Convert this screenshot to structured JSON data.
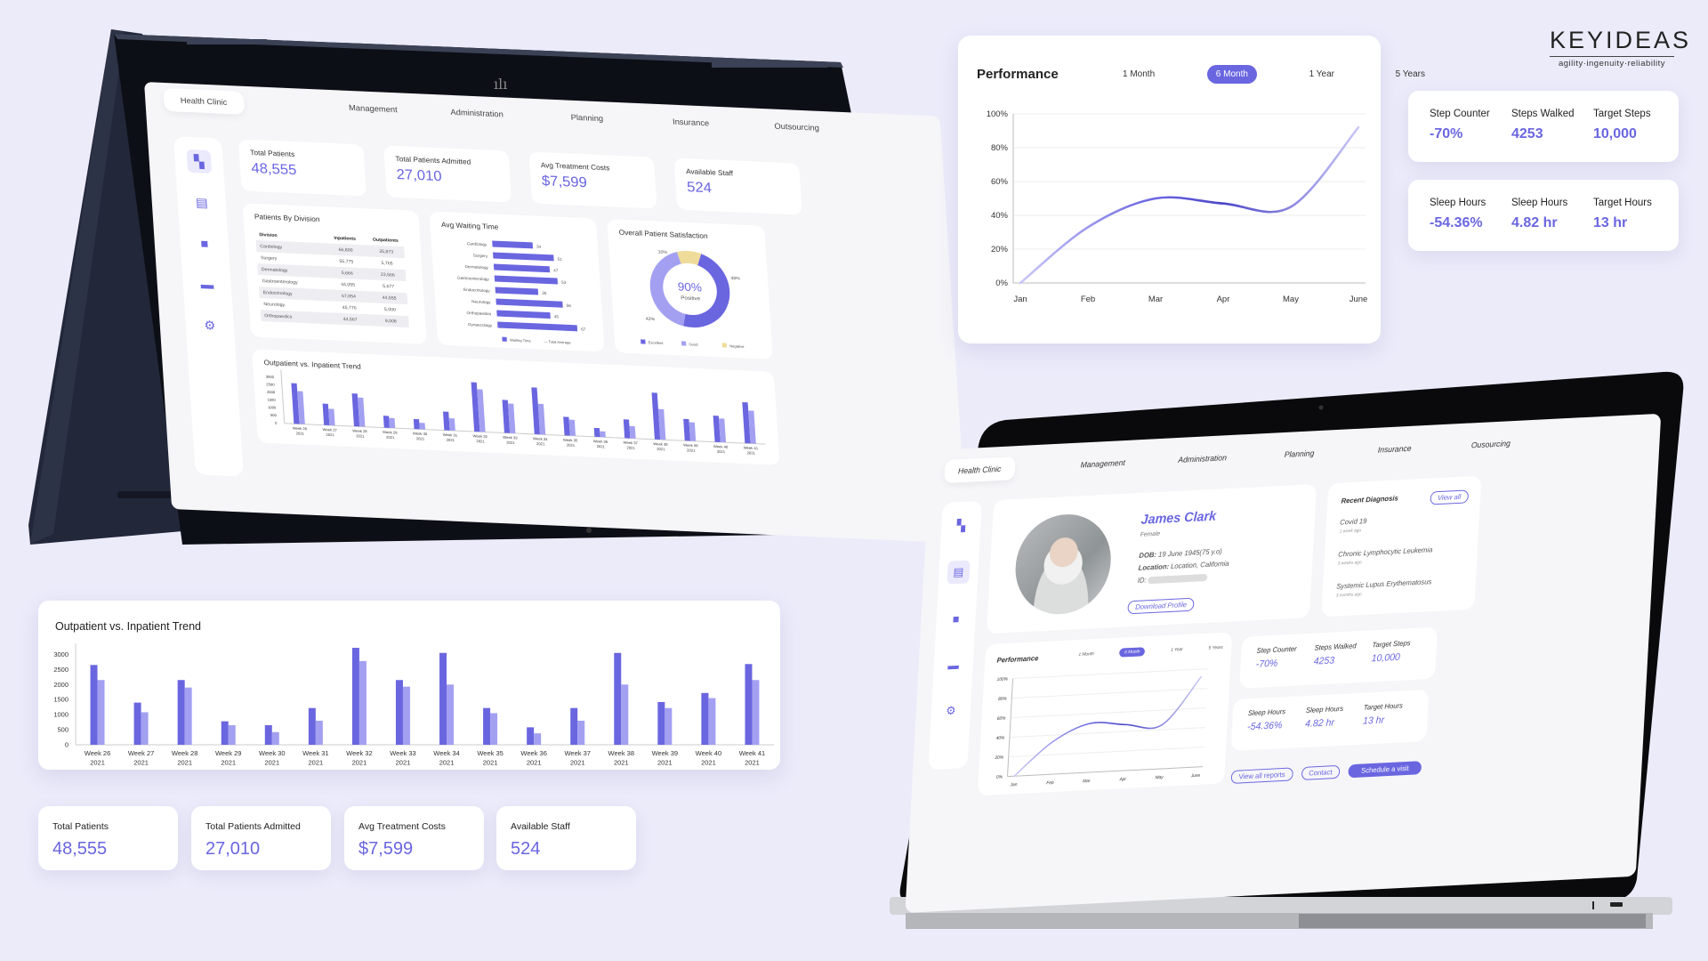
{
  "brand": {
    "logo_name": "KEYIDEAS",
    "logo_tagline": "agility·ingenuity·reliability"
  },
  "colors": {
    "accent": "#6a66e0",
    "accent_light": "#a3a0f2",
    "negative_yellow": "#f0dc9a",
    "background": "#ecebfa"
  },
  "nav": {
    "brand": "Health Clinic",
    "items": [
      "Management",
      "Administration",
      "Planning",
      "Insurance",
      "Outsourcing"
    ],
    "laptop_items": [
      "Management",
      "Administration",
      "Planning",
      "Insurance",
      "Ousourcing"
    ]
  },
  "sidebar_icons": [
    "dashboard-icon",
    "card-icon",
    "briefcase-icon",
    "folder-icon",
    "gear-icon"
  ],
  "kpis": [
    {
      "label": "Total Patients",
      "value": "48,555"
    },
    {
      "label": "Total Patients Admitted",
      "value": "27,010"
    },
    {
      "label": "Avg Treatment Costs",
      "value": "$7,599"
    },
    {
      "label": "Available Staff",
      "value": "524"
    }
  ],
  "performance": {
    "title": "Performance",
    "tabs": [
      "1 Month",
      "6 Month",
      "1 Year",
      "5 Years"
    ],
    "active_tab": "6 Month"
  },
  "steps": {
    "row1": [
      {
        "label": "Step Counter",
        "value": "-70%"
      },
      {
        "label": "Steps Walked",
        "value": "4253"
      },
      {
        "label": "Target Steps",
        "value": "10,000"
      }
    ],
    "row2": [
      {
        "label": "Sleep Hours",
        "value": "-54.36%"
      },
      {
        "label": "Sleep Hours",
        "value": "4.82 hr"
      },
      {
        "label": "Target Hours",
        "value": "13 hr"
      }
    ]
  },
  "patients_by_division": {
    "title": "Patients By Division",
    "columns": [
      "Division",
      "Inpatients",
      "Outpatients"
    ],
    "rows": [
      [
        "Cardiology",
        "66,800",
        "35,873"
      ],
      [
        "Surgery",
        "55,775",
        "5,765"
      ],
      [
        "Dermatology",
        "5,666",
        "23,566"
      ],
      [
        "Gastroenterology",
        "44,055",
        "5,677"
      ],
      [
        "Endocrinology",
        "67,854",
        "44,555"
      ],
      [
        "Neurology",
        "45,776",
        "5,000"
      ],
      [
        "Orthopaedics",
        "44,567",
        "9,008"
      ]
    ]
  },
  "patient_profile": {
    "name": "James Clark",
    "gender": "Female",
    "dob_label": "DOB:",
    "dob": "19 June 1945(75 y.o)",
    "location_label": "Location:",
    "location": "Location, California",
    "id_label": "ID:",
    "download_label": "Download Profile"
  },
  "recent_diagnosis": {
    "title": "Recent Diagnosis",
    "view_all": "View all",
    "items": [
      {
        "name": "Covid 19",
        "when": "1 week ago"
      },
      {
        "name": "Chronic Lymphocytic Leukemia",
        "when": "3 weeks ago"
      },
      {
        "name": "Systemic Lupus Erythematosus",
        "when": "3 months ago"
      }
    ]
  },
  "laptop_actions": {
    "view_reports": "View all reports",
    "contact": "Contact",
    "schedule": "Schedule a visit"
  },
  "chart_data": [
    {
      "id": "performance",
      "type": "line",
      "title": "Performance",
      "categories": [
        "Jan",
        "Feb",
        "Mar",
        "Apr",
        "May",
        "June"
      ],
      "x": [
        0,
        1,
        2,
        3,
        4,
        5
      ],
      "series": [
        {
          "name": "Performance",
          "values": [
            0,
            33,
            50,
            47,
            45,
            92
          ]
        }
      ],
      "yticks": [
        "0%",
        "20%",
        "40%",
        "60%",
        "80%",
        "100%"
      ],
      "ylim": [
        0,
        100
      ],
      "grid": true
    },
    {
      "id": "outpatient-inpatient-trend",
      "type": "bar",
      "title": "Outpatient vs. Inpatient Trend",
      "categories": [
        "Week 26",
        "Week 27",
        "Week 28",
        "Week 29",
        "Week 30",
        "Week 31",
        "Week 32",
        "Week 33",
        "Week 34",
        "Week 35",
        "Week 36",
        "Week 37",
        "Week 38",
        "Week 39",
        "Week 40",
        "Week 41"
      ],
      "category_sublabel": "2021",
      "series": [
        {
          "name": "Outpatient",
          "values": [
            2650,
            1400,
            2150,
            780,
            650,
            1220,
            3220,
            2150,
            3050,
            1220,
            580,
            1220,
            3050,
            1420,
            1720,
            2680
          ]
        },
        {
          "name": "Inpatient",
          "values": [
            2150,
            1080,
            1900,
            650,
            420,
            800,
            2780,
            1930,
            2000,
            1050,
            380,
            800,
            2000,
            1220,
            1550,
            2150
          ]
        }
      ],
      "yticks": [
        0,
        500,
        1000,
        1500,
        2000,
        2500,
        3000
      ],
      "ylim": [
        0,
        3250
      ],
      "grid": false
    },
    {
      "id": "avg-waiting-time",
      "type": "bar",
      "title": "Avg Waiting Time",
      "categories": [
        "Cardiology",
        "Surgery",
        "Dermatology",
        "Gastroenterology",
        "Endocrinology",
        "Neurology",
        "Orthopaedics",
        "Gynaecology"
      ],
      "series": [
        {
          "name": "Waiting Time",
          "values": [
            34,
            51,
            47,
            53,
            36,
            56,
            45,
            67
          ]
        }
      ],
      "legend": [
        "Waiting Time",
        "Total Average"
      ]
    },
    {
      "id": "overall-patient-satisfaction",
      "type": "pie",
      "title": "Overall Patient Satisfaction",
      "center_value": "90%",
      "center_label": "Positive",
      "slices": [
        {
          "label": "Excellent",
          "value": 48
        },
        {
          "label": "Good",
          "value": 42
        },
        {
          "label": "Negative",
          "value": 10
        }
      ]
    }
  ]
}
